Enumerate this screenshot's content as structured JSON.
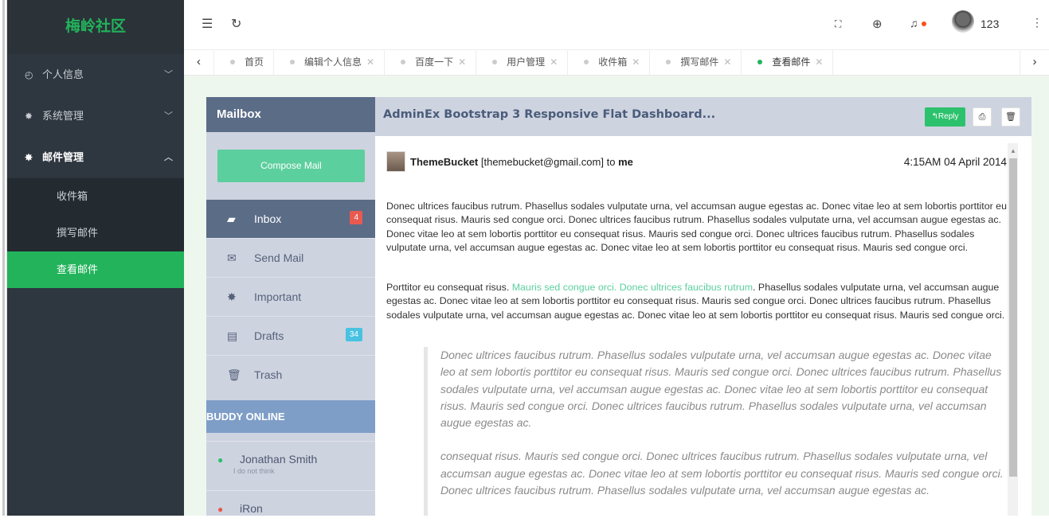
{
  "sidebar": {
    "logo": "梅岭社区",
    "menus": [
      {
        "label": "个人信息",
        "icon": "dashboard-icon"
      },
      {
        "label": "系统管理",
        "icon": "gear-icon"
      },
      {
        "label": "邮件管理",
        "icon": "gear-icon"
      }
    ],
    "submenu": [
      "收件箱",
      "撰写邮件",
      "查看邮件"
    ]
  },
  "topbar": {
    "username": "123"
  },
  "tabs": [
    {
      "label": "首页",
      "closable": false
    },
    {
      "label": "编辑个人信息",
      "closable": true
    },
    {
      "label": "百度一下",
      "closable": true
    },
    {
      "label": "用户管理",
      "closable": true
    },
    {
      "label": "收件箱",
      "closable": true
    },
    {
      "label": "撰写邮件",
      "closable": true
    },
    {
      "label": "查看邮件",
      "closable": true,
      "active": true
    }
  ],
  "mailbox": {
    "title": "Mailbox",
    "compose_label": "Compose Mail",
    "folders": [
      {
        "label": "Inbox",
        "badge": "4",
        "icon": "inbox-icon"
      },
      {
        "label": "Send Mail",
        "icon": "envelope-icon"
      },
      {
        "label": "Important",
        "icon": "gear-icon"
      },
      {
        "label": "Drafts",
        "badge": "34",
        "icon": "document-icon"
      },
      {
        "label": "Trash",
        "icon": "trash-icon"
      }
    ],
    "buddy_title": "BUDDY ONLINE",
    "buddies": [
      {
        "name": "Jonathan Smith",
        "status": "I do not think"
      },
      {
        "name": "iRon",
        "status": ""
      }
    ]
  },
  "message": {
    "title": "AdminEx Bootstrap 3 Responsive Flat Dashboard...",
    "reply_label": "Reply",
    "sender_name": "ThemeBucket",
    "sender_email": "[themebucket@gmail.com]",
    "to_word": "to",
    "recipient": "me",
    "date": "4:15AM 04 April 2014",
    "para1": "Donec ultrices faucibus rutrum. Phasellus sodales vulputate urna, vel accumsan augue egestas ac. Donec vitae leo at sem lobortis porttitor eu consequat risus. Mauris sed congue orci. Donec ultrices faucibus rutrum. Phasellus sodales vulputate urna, vel accumsan augue egestas ac. Donec vitae leo at sem lobortis porttitor eu consequat risus. Mauris sed congue orci. Donec ultrices faucibus rutrum. Phasellus sodales vulputate urna, vel accumsan augue egestas ac. Donec vitae leo at sem lobortis porttitor eu consequat risus. Mauris sed congue orci.",
    "para2_start": "Porttitor eu consequat risus. ",
    "para2_link": "Mauris sed congue orci. Donec ultrices faucibus rutrum",
    "para2_end": ". Phasellus sodales vulputate urna, vel accumsan augue egestas ac. Donec vitae leo at sem lobortis porttitor eu consequat risus. Mauris sed congue orci. Donec ultrices faucibus rutrum. Phasellus sodales vulputate urna, vel accumsan augue egestas ac. Donec vitae leo at sem lobortis porttitor eu consequat risus. Mauris sed congue orci.",
    "quote1": "Donec ultrices faucibus rutrum. Phasellus sodales vulputate urna, vel accumsan augue egestas ac. Donec vitae leo at sem lobortis porttitor eu consequat risus. Mauris sed congue orci. Donec ultrices faucibus rutrum. Phasellus sodales vulputate urna, vel accumsan augue egestas ac. Donec vitae leo at sem lobortis porttitor eu consequat risus. Mauris sed congue orci. Donec ultrices faucibus rutrum. Phasellus sodales vulputate urna, vel accumsan augue egestas ac.",
    "quote2": "consequat risus. Mauris sed congue orci. Donec ultrices faucibus rutrum. Phasellus sodales vulputate urna, vel accumsan augue egestas ac. Donec vitae leo at sem lobortis porttitor eu consequat risus. Mauris sed congue orci. Donec ultrices faucibus rutrum. Phasellus sodales vulputate urna, vel accumsan augue egestas ac."
  },
  "colors": {
    "accent": "#22b35b",
    "mailbox_header": "#5b6c87",
    "compose": "#5ccf9e",
    "buddy_header": "#7e9ec7"
  }
}
